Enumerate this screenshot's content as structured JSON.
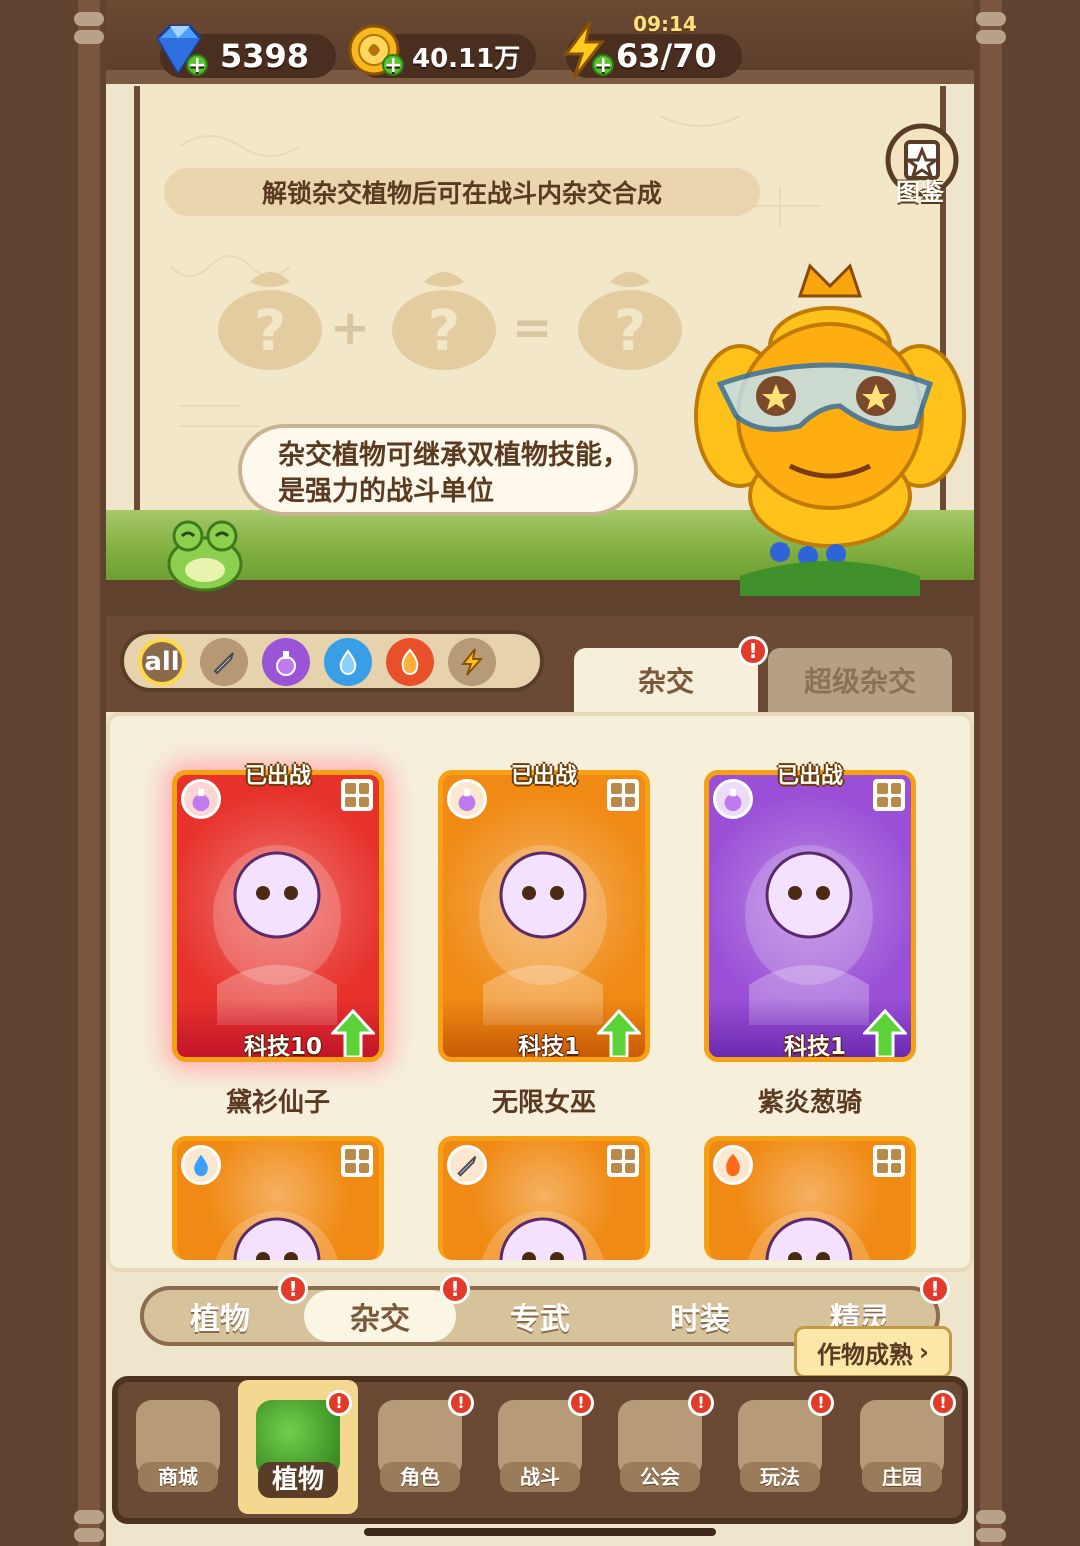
{
  "status": {
    "clock": "09:14"
  },
  "resources": {
    "gems": "5398",
    "coins": "40.11万",
    "energy": "63/70"
  },
  "banner": {
    "hint": "解锁杂交植物后可在战斗内杂交合成",
    "codex_label": "图鉴",
    "speech": "杂交植物可继承双植物技能，是强力的战斗单位"
  },
  "filters": {
    "all_label": "all",
    "element_icons": [
      "sword-icon",
      "potion-icon",
      "water-drop-icon",
      "fire-icon",
      "lightning-icon"
    ]
  },
  "top_tabs": [
    {
      "label": "杂交",
      "active": true
    },
    {
      "label": "超级杂交",
      "active": false
    }
  ],
  "cards": [
    {
      "name": "黛衫仙子",
      "tech": "科技10",
      "deployed": "已出战",
      "element": "potion-icon",
      "color": "#e7322b"
    },
    {
      "name": "无限女巫",
      "tech": "科技1",
      "deployed": "已出战",
      "element": "potion-icon",
      "color": "#f08a14"
    },
    {
      "name": "紫炎葱骑",
      "tech": "科技1",
      "deployed": "已出战",
      "element": "potion-icon",
      "color": "#9a4fd6"
    },
    {
      "name": "",
      "tech": "",
      "deployed": "",
      "element": "water-drop-icon",
      "color": "#f08a14"
    },
    {
      "name": "",
      "tech": "",
      "deployed": "",
      "element": "sword-icon",
      "color": "#f08a14"
    },
    {
      "name": "",
      "tech": "",
      "deployed": "",
      "element": "fire-icon",
      "color": "#f08a14"
    }
  ],
  "sub_tabs": [
    "植物",
    "杂交",
    "专武",
    "时装",
    "精灵"
  ],
  "ripe_button": "作物成熟",
  "nav": [
    "商城",
    "植物",
    "角色",
    "战斗",
    "公会",
    "玩法",
    "庄园"
  ],
  "colors": {
    "accent": "#f6a014",
    "badge": "#e23b2a",
    "wood": "#6b4a35"
  }
}
